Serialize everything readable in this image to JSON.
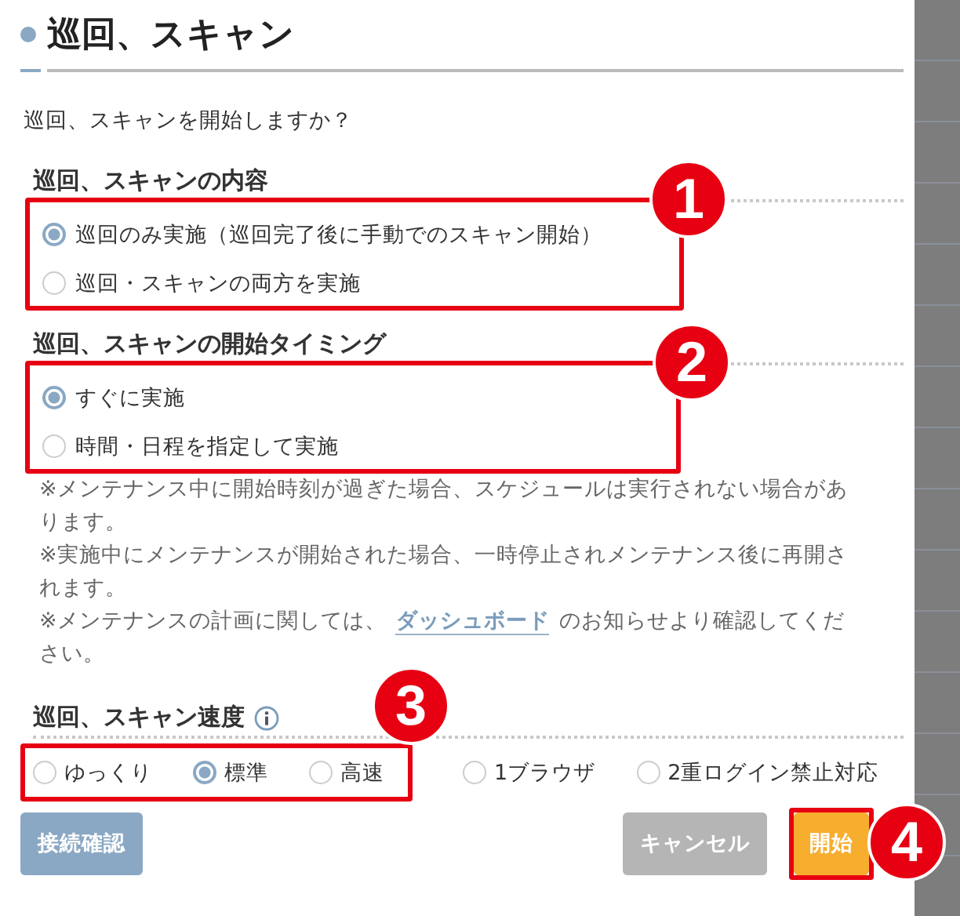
{
  "dialog": {
    "title": "巡回、スキャン",
    "prompt": "巡回、スキャンを開始しますか？",
    "sections": [
      {
        "heading": "巡回、スキャンの内容",
        "options": [
          {
            "label": "巡回のみ実施（巡回完了後に手動でのスキャン開始）",
            "selected": true
          },
          {
            "label": "巡回・スキャンの両方を実施",
            "selected": false
          }
        ]
      },
      {
        "heading": "巡回、スキャンの開始タイミング",
        "options": [
          {
            "label": "すぐに実施",
            "selected": true
          },
          {
            "label": "時間・日程を指定して実施",
            "selected": false
          }
        ]
      }
    ],
    "notes": [
      {
        "text": "※メンテナンス中に開始時刻が過ぎた場合、スケジュールは実行されない場合があります。"
      },
      {
        "text": "※実施中にメンテナンスが開始された場合、一時停止されメンテナンス後に再開されます。"
      },
      {
        "text": "※メンテナンスの計画に関しては、",
        "link": "ダッシュボード",
        "after": "のお知らせより確認してください。"
      }
    ],
    "speed": {
      "heading": "巡回、スキャン速度",
      "options": [
        {
          "label": "ゆっくり",
          "selected": false
        },
        {
          "label": "標準",
          "selected": true
        },
        {
          "label": "高速",
          "selected": false
        }
      ],
      "extra_options": [
        {
          "label": "1ブラウザ",
          "selected": false
        },
        {
          "label": "2重ログイン禁止対応",
          "selected": false
        }
      ]
    },
    "buttons": [
      {
        "label": "接続確認",
        "kind": "secondary"
      },
      {
        "label": "キャンセル",
        "kind": "cancel"
      },
      {
        "label": "開始",
        "kind": "primary"
      }
    ]
  },
  "annotations": [
    {
      "number": "1"
    },
    {
      "number": "2"
    },
    {
      "number": "3"
    },
    {
      "number": "4"
    }
  ]
}
